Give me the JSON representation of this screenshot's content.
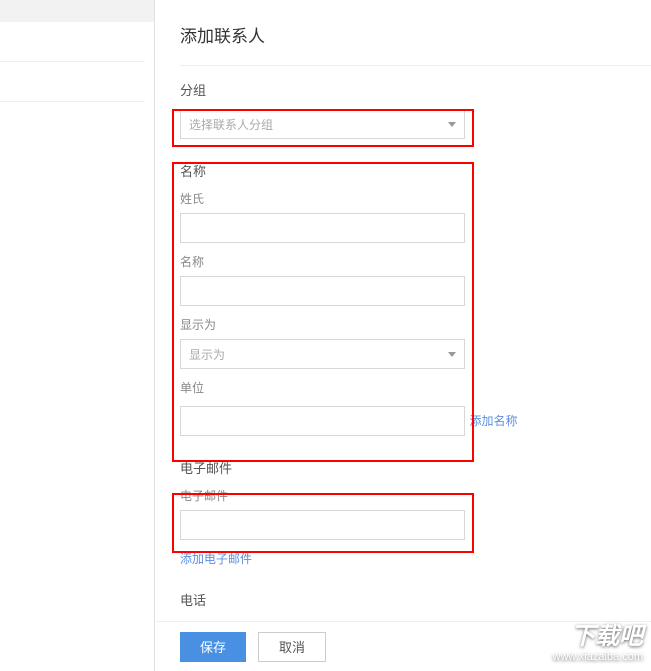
{
  "title": "添加联系人",
  "sections": {
    "group": {
      "header": "分组",
      "placeholder": "选择联系人分组"
    },
    "name": {
      "header": "名称",
      "surname_label": "姓氏",
      "given_label": "名称",
      "display_label": "显示为",
      "display_placeholder": "显示为",
      "org_label": "单位",
      "add_link": "添加名称"
    },
    "email": {
      "header": "电子邮件",
      "field_label": "电子邮件",
      "add_link": "添加电子邮件"
    },
    "phone": {
      "header": "电话"
    }
  },
  "footer": {
    "save": "保存",
    "cancel": "取消"
  },
  "watermark": {
    "brand": "下载吧",
    "url": "www.xiazaiba.com"
  }
}
